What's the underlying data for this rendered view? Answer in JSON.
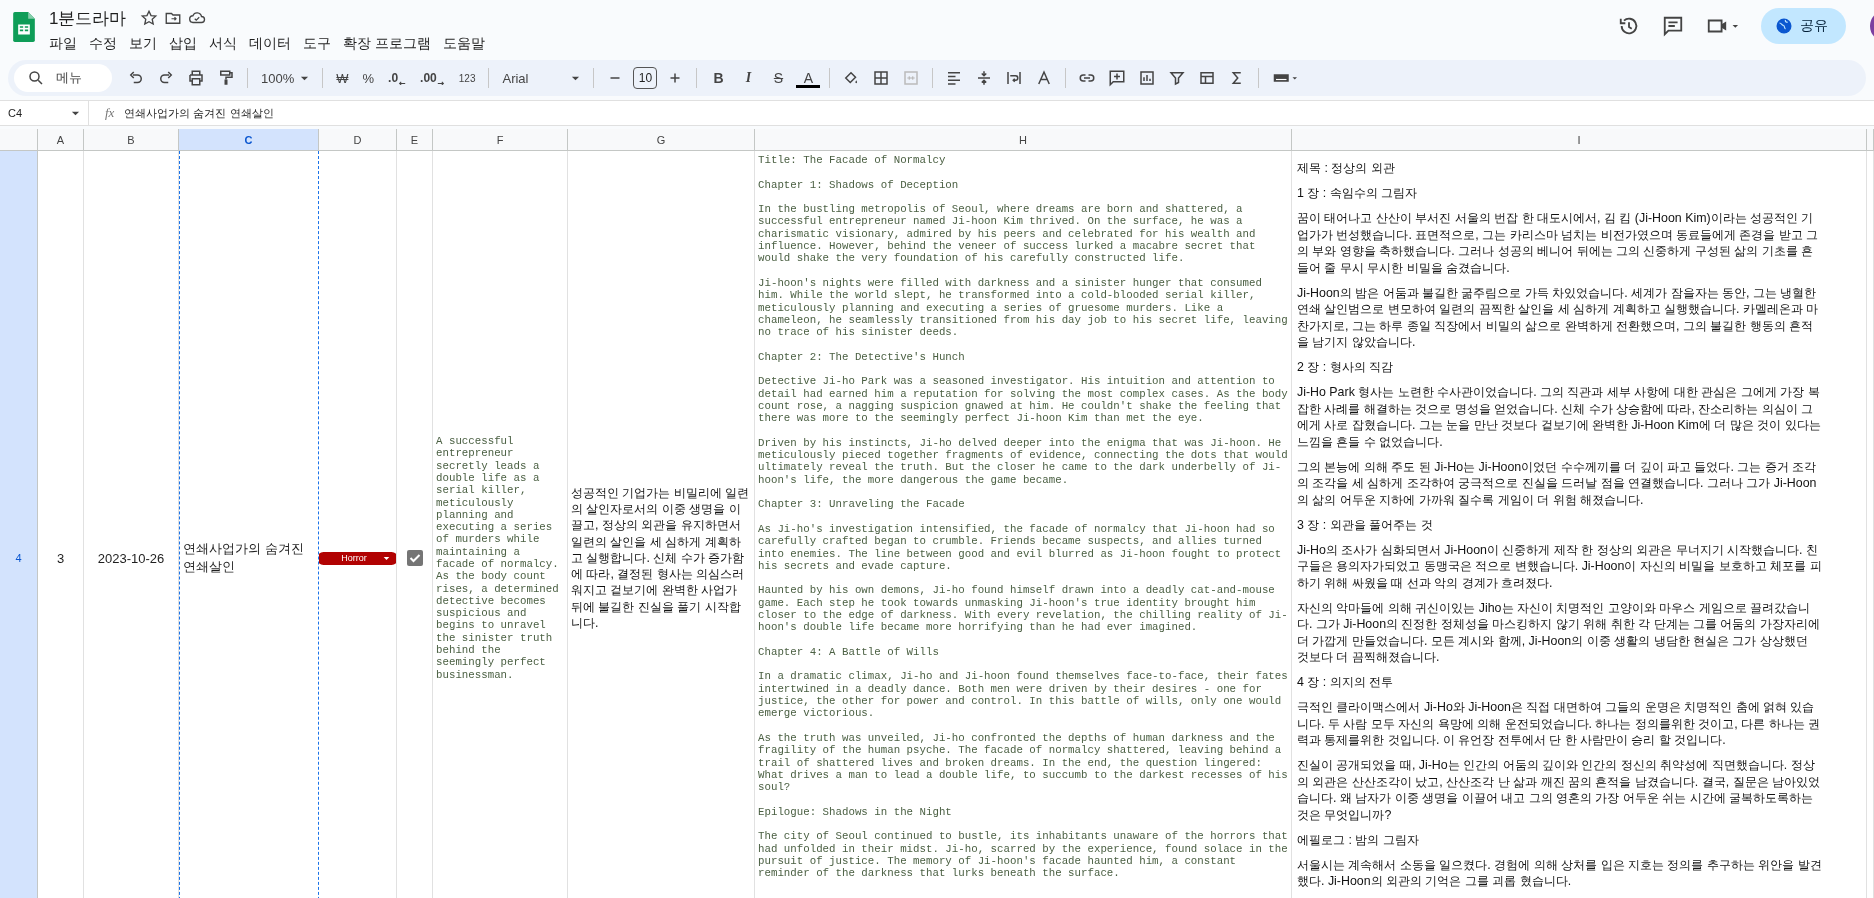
{
  "document": {
    "title": "1분드라마"
  },
  "menu": [
    "파일",
    "수정",
    "보기",
    "삽입",
    "서식",
    "데이터",
    "도구",
    "확장 프로그램",
    "도움말"
  ],
  "share_button": "공유",
  "toolbar": {
    "search": "메뉴",
    "zoom": "100%",
    "currency": "₩",
    "percent": "%",
    "decrease_decimals": ".0",
    "increase_decimals": ".00",
    "number_format": "123",
    "font": "Arial",
    "font_size": "10",
    "bold": "B",
    "italic": "I",
    "strikethrough": "S",
    "text_color": "A"
  },
  "formula_bar": {
    "cell_ref": "C4",
    "fx": "fx",
    "content": "연쇄사업가의 숨겨진 연쇄살인"
  },
  "sheet": {
    "columns": [
      {
        "label": "A",
        "selected": false
      },
      {
        "label": "B",
        "selected": false
      },
      {
        "label": "C",
        "selected": true
      },
      {
        "label": "D",
        "selected": false
      },
      {
        "label": "E",
        "selected": false
      },
      {
        "label": "F",
        "selected": false
      },
      {
        "label": "G",
        "selected": false
      },
      {
        "label": "H",
        "selected": false
      },
      {
        "label": "I",
        "selected": false
      }
    ],
    "row": {
      "number": "4",
      "selected": true,
      "id": "3",
      "date": "2023-10-26",
      "title": "연쇄사업가의 숨겨진 연쇄살인",
      "genre": {
        "label": "Horror",
        "color": "#b10202"
      },
      "done": true,
      "summary_en": "A successful entrepreneur secretly leads a double life as a serial killer, meticulously planning and executing a series of murders while maintaining a facade of normalcy. As the body count rises, a determined detective becomes suspicious and begins to unravel the sinister truth behind the seemingly perfect businessman.",
      "summary_ko": "성공적인 기업가는 비밀리에 일련의 살인자로서의 이중 생명을 이끌고, 정상의 외관을 유지하면서 일련의 살인을 세 심하게 계획하고 실행합니다. 신체 수가 증가함에 따라, 결정된 형사는 의심스러워지고 겉보기에 완벽한 사업가 뒤에 불길한 진실을 풀기 시작합니다.",
      "story_en": [
        "Title: The Facade of Normalcy",
        "Chapter 1: Shadows of Deception",
        "In the bustling metropolis of Seoul, where dreams are born and shattered, a successful entrepreneur named Ji-hoon Kim thrived. On the surface, he was a charismatic visionary, admired by his peers and celebrated for his wealth and influence. However, behind the veneer of success lurked a macabre secret that would shake the very foundation of his carefully constructed life.",
        "Ji-hoon's nights were filled with darkness and a sinister hunger that consumed him. While the world slept, he transformed into a cold-blooded serial killer, meticulously planning and executing a series of gruesome murders. Like a chameleon, he seamlessly transitioned from his day job to his secret life, leaving no trace of his sinister deeds.",
        "Chapter 2: The Detective's Hunch",
        "Detective Ji-ho Park was a seasoned investigator. His intuition and attention to detail had earned him a reputation for solving the most complex cases. As the body count rose, a nagging suspicion gnawed at him. He couldn't shake the feeling that there was more to the seemingly perfect Ji-hoon Kim than met the eye.",
        "Driven by his instincts, Ji-ho delved deeper into the enigma that was Ji-hoon. He meticulously pieced together fragments of evidence, connecting the dots that would ultimately reveal the truth. But the closer he came to the dark underbelly of Ji-hoon's life, the more dangerous the game became.",
        "Chapter 3: Unraveling the Facade",
        "As Ji-ho's investigation intensified, the facade of normalcy that Ji-hoon had so carefully crafted began to crumble. Friends became suspects, and allies turned into enemies. The line between good and evil blurred as Ji-hoon fought to protect his secrets and evade capture.",
        "Haunted by his own demons, Ji-ho found himself drawn into a deadly cat-and-mouse game. Each step he took towards unmasking Ji-hoon's true identity brought him closer to the edge of darkness. With every revelation, the chilling reality of Ji-hoon's double life became more horrifying than he had ever imagined.",
        "Chapter 4: A Battle of Wills",
        "In a dramatic climax, Ji-ho and Ji-hoon found themselves face-to-face, their fates intertwined in a deadly dance. Both men were driven by their desires - one for justice, the other for power and control. In this battle of wills, only one would emerge victorious.",
        "As the truth was unveiled, Ji-ho confronted the depths of human darkness and the fragility of the human psyche. The facade of normalcy shattered, leaving behind a trail of shattered lives and broken dreams. In the end, the question lingered: What drives a man to lead a double life, to succumb to the darkest recesses of his soul?",
        "Epilogue: Shadows in the Night",
        "The city of Seoul continued to bustle, its inhabitants unaware of the horrors that had unfolded in their midst. Ji-ho, scarred by the experience, found solace in the pursuit of justice. The memory of Ji-hoon's facade haunted him, a constant reminder of the darkness that lurks beneath the surface."
      ],
      "story_ko": [
        "제목 : 정상의 외관",
        "1 장 : 속임수의 그림자",
        "꿈이 태어나고 산산이 부서진 서울의 번잡 한 대도시에서, 김 킴 (Ji-Hoon Kim)이라는 성공적인 기업가가 번성했습니다. 표면적으로, 그는 카리스마 넘치는 비전가였으며 동료들에게 존경을 받고 그의 부와 영향을 축하했습니다. 그러나 성공의 베니어 뒤에는 그의 신중하게 구성된 삶의 기초를 흔들어 줄 무시 무시한 비밀을 숨겼습니다.",
        "Ji-Hoon의 밤은 어둠과 불길한 굶주림으로 가득 차있었습니다. 세계가 잠을자는 동안, 그는 냉혈한 연쇄 살인범으로 변모하여 일련의 끔찍한 살인을 세 심하게 계획하고 실행했습니다. 카멜레온과 마찬가지로, 그는 하루 종일 직장에서 비밀의 삶으로 완벽하게 전환했으며, 그의 불길한 행동의 흔적을 남기지 않았습니다.",
        "2 장 : 형사의 직감",
        "Ji-Ho Park 형사는 노련한 수사관이었습니다. 그의 직관과 세부 사항에 대한 관심은 그에게 가장 복잡한 사례를 해결하는 것으로 명성을 얻었습니다. 신체 수가 상승함에 따라, 잔소리하는 의심이 그에게 사로 잡혔습니다. 그는 눈을 만난 것보다 겉보기에 완벽한 Ji-Hoon Kim에 더 많은 것이 있다는 느낌을 흔들 수 없었습니다.",
        "그의 본능에 의해 주도 된 Ji-Ho는 Ji-Hoon이었던 수수께끼를 더 깊이 파고 들었다. 그는 증거 조각의 조각을 세 심하게 조각하여 궁극적으로 진실을 드러날 점을 연결했습니다. 그러나 그가 Ji-Hoon의 삶의 어두운 지하에 가까워 질수록 게임이 더 위험 해졌습니다.",
        "3 장 : 외관을 풀어주는 것",
        "Ji-Ho의 조사가 심화되면서 Ji-Hoon이 신중하게 제작 한 정상의 외관은 무너지기 시작했습니다. 친구들은 용의자가되었고 동맹국은 적으로 변했습니다. Ji-Hoon이 자신의 비밀을 보호하고 체포를 피하기 위해 싸웠을 때 선과 악의 경계가 흐려졌다.",
        "자신의 악마들에 의해 귀신이있는 Jiho는 자신이 치명적인 고양이와 마우스 게임으로 끌려갔습니다. 그가 Ji-Hoon의 진정한 정체성을 마스킹하지 않기 위해 취한 각 단계는 그를 어둠의 가장자리에 더 가깝게 만들었습니다. 모든 계시와 함께, Ji-Hoon의 이중 생활의 냉담한 현실은 그가 상상했던 것보다 더 끔찍해졌습니다.",
        "4 장 : 의지의 전투",
        "극적인 클라이맥스에서 Ji-Ho와 Ji-Hoon은 직접 대면하여 그들의 운명은 치명적인 춤에 얽혀 있습니다. 두 사람 모두 자신의 욕망에 의해 운전되었습니다. 하나는 정의를위한 것이고, 다른 하나는 권력과 통제를위한 것입니다. 이 유언장 전투에서 단 한 사람만이 승리 할 것입니다.",
        "진실이 공개되었을 때, Ji-Ho는 인간의 어둠의 깊이와 인간의 정신의 취약성에 직면했습니다. 정상의 외관은 산산조각이 났고, 산산조각 난 삶과 깨진 꿈의 흔적을 남겼습니다. 결국, 질문은 남아있었습니다. 왜 남자가 이중 생명을 이끌어 내고 그의 영혼의 가장 어두운 쉬는 시간에 굴복하도록하는 것은 무엇입니까?",
        "에필로그 : 밤의 그림자",
        "서울시는 계속해서 소동을 일으켰다. 경험에 의해 상처를 입은 지호는 정의를 추구하는 위안을 발견했다. Ji-Hoon의 외관의 기억은 그를 괴롭 혔습니다."
      ]
    }
  }
}
